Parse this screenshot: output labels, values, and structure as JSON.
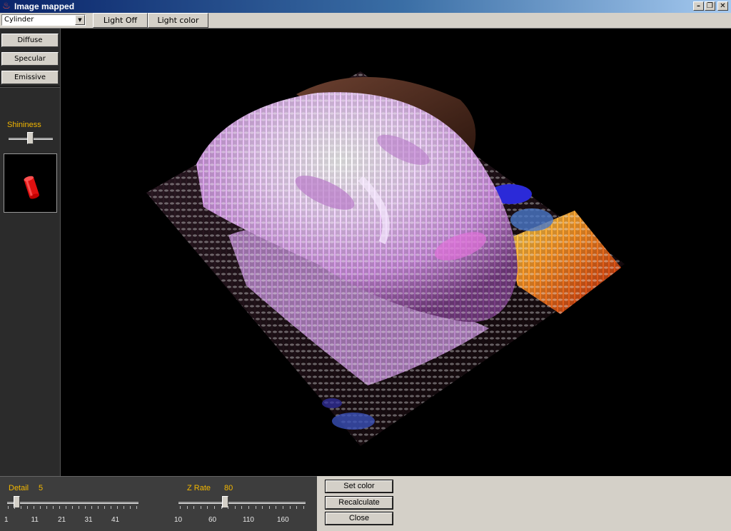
{
  "window": {
    "title": "Image mapped",
    "icon": "java-cup-icon"
  },
  "toolbar": {
    "shape_select": {
      "value": "Cylinder"
    },
    "light_off_label": "Light Off",
    "light_color_label": "Light color"
  },
  "left_panel": {
    "diffuse_label": "Diffuse",
    "specular_label": "Specular",
    "emissive_label": "Emissive",
    "shininess_label": "Shininess",
    "shininess_level": 0.5,
    "preview_shape": "red-cylinder",
    "preview_color": "#e01010"
  },
  "bottom": {
    "detail": {
      "label": "Detail",
      "value": "5",
      "ticks": [
        "1",
        "11",
        "21",
        "31",
        "41"
      ]
    },
    "zrate": {
      "label": "Z Rate",
      "value": "80",
      "ticks": [
        "10",
        "60",
        "110",
        "160"
      ]
    },
    "set_color_label": "Set color",
    "recalculate_label": "Recalculate",
    "close_label": "Close"
  },
  "colors": {
    "accent_label": "#f3b700",
    "panel_dark": "#2b2b2b",
    "chrome": "#d4d0c8"
  }
}
